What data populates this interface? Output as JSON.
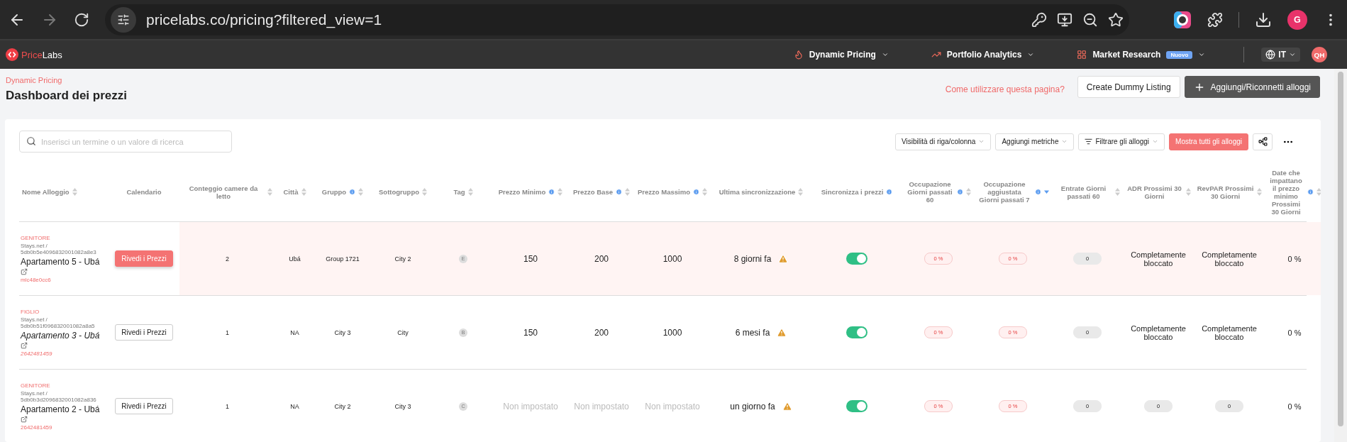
{
  "browser": {
    "url": "pricelabs.co/pricing?filtered_view=1",
    "forward_disabled": true,
    "profile": "G"
  },
  "app_nav": {
    "logo": [
      "Price",
      "Labs"
    ],
    "items": [
      {
        "label": "Dynamic Pricing"
      },
      {
        "label": "Portfolio Analytics"
      },
      {
        "label": "Market Research",
        "badge": "Nuovo"
      }
    ],
    "language": "IT",
    "user": "QH"
  },
  "page": {
    "breadcrumb": "Dynamic Pricing",
    "title": "Dashboard dei prezzi",
    "help_link": "Come utilizzare questa pagina?",
    "buttons": [
      {
        "label": "Create Dummy Listing",
        "kind": "outline"
      },
      {
        "label": "Aggiungi/Riconnetti alloggi",
        "kind": "dark"
      }
    ]
  },
  "toolbar": {
    "search_placeholder": "Inserisci un termine o un valore di ricerca",
    "controls": [
      {
        "label": "Visibilità di riga/colonna",
        "kind": "dropdown"
      },
      {
        "label": "Aggiungi metriche",
        "kind": "dropdown"
      },
      {
        "label": "Filtrare gli alloggi",
        "kind": "filter"
      },
      {
        "label": "Mostra tutti gli alloggi",
        "kind": "primary"
      }
    ]
  },
  "table": {
    "columns": [
      {
        "label": "Nome Alloggio",
        "info": false,
        "sortable": true,
        "sorted": false
      },
      {
        "label": "Calendario",
        "info": false,
        "sortable": false
      },
      {
        "label": "Conteggio camere da letto",
        "info": false,
        "sortable": true,
        "sorted": false
      },
      {
        "label": "Città",
        "info": false,
        "sortable": true,
        "sorted": false
      },
      {
        "label": "Gruppo",
        "info": true,
        "sortable": true,
        "sorted": false
      },
      {
        "label": "Sottogruppo",
        "info": false,
        "sortable": true,
        "sorted": false
      },
      {
        "label": "Tag",
        "info": false,
        "sortable": true,
        "sorted": false
      },
      {
        "label": "Prezzo Minimo",
        "info": true,
        "sortable": true,
        "sorted": false
      },
      {
        "label": "Prezzo Base",
        "info": true,
        "sortable": true,
        "sorted": false
      },
      {
        "label": "Prezzo Massimo",
        "info": true,
        "sortable": true,
        "sorted": false
      },
      {
        "label": "Ultima sincronizzazione",
        "info": false,
        "sortable": true,
        "sorted": false
      },
      {
        "label": "Sincronizza i prezzi",
        "info": true,
        "sortable": false
      },
      {
        "label": "Occupazione Giorni passati 60",
        "info": true,
        "sortable": true,
        "sorted": false
      },
      {
        "label": "Occupazione aggiustata Giorni passati 7",
        "info": true,
        "sortable": true,
        "sorted": true
      },
      {
        "label": "Entrate Giorni passati 60",
        "info": false,
        "sortable": true,
        "sorted": false
      },
      {
        "label": "ADR Prossimi 30 Giorni",
        "info": false,
        "sortable": true,
        "sorted": false
      },
      {
        "label": "RevPAR Prossimi 30 Giorni",
        "info": false,
        "sortable": true,
        "sorted": false
      },
      {
        "label": "Date che impattano il prezzo minimo Prossimi 30 Giorni",
        "info": true,
        "sortable": true,
        "sorted": false
      }
    ],
    "rows": [
      {
        "selected": true,
        "kind": "parent",
        "role": "GENITORE",
        "source": "Stays.net / 5db0b5e4096832001082a8e3",
        "name": "Apartamento 5 - Ubá",
        "id": "mlc48e0cc6",
        "button": "Rivedi i Prezzi",
        "bedrooms": "2",
        "city": "Ubá",
        "group": "Group 1721",
        "subgroup": "City 2",
        "tag": "E",
        "prices": [
          {
            "text": "150",
            "set": true
          },
          {
            "text": "200",
            "set": true
          },
          {
            "text": "1000",
            "set": true
          }
        ],
        "last_sync": "8 giorni fa",
        "sync_on": true,
        "metrics": [
          {
            "text": "0 %",
            "kind": "red-pill"
          },
          {
            "text": "0 %",
            "kind": "red-pill"
          },
          {
            "text": "0",
            "kind": "grey-pill"
          },
          {
            "text": "Completamente bloccato",
            "kind": "text"
          },
          {
            "text": "Completamente bloccato",
            "kind": "text"
          },
          {
            "text": "0 %",
            "kind": "text"
          }
        ]
      },
      {
        "selected": false,
        "kind": "child",
        "role": "FIGLIO",
        "source": "Stays.net / 5db0b51f096832001082a8a5",
        "name": "Apartamento 3 - Ubá",
        "id": "2642481459",
        "button": "Rivedi i Prezzi",
        "bedrooms": "1",
        "city": "NA",
        "group": "City 3",
        "subgroup": "City",
        "tag": "B",
        "prices": [
          {
            "text": "150",
            "set": true
          },
          {
            "text": "200",
            "set": true
          },
          {
            "text": "1000",
            "set": true
          }
        ],
        "last_sync": "6 mesi fa",
        "sync_on": true,
        "metrics": [
          {
            "text": "0 %",
            "kind": "red-pill"
          },
          {
            "text": "0 %",
            "kind": "red-pill"
          },
          {
            "text": "0",
            "kind": "grey-pill"
          },
          {
            "text": "Completamente bloccato",
            "kind": "text"
          },
          {
            "text": "Completamente bloccato",
            "kind": "text"
          },
          {
            "text": "0 %",
            "kind": "text"
          }
        ]
      },
      {
        "selected": false,
        "kind": "parent",
        "role": "GENITORE",
        "source": "Stays.net / 5db0b3d2096832001082a836",
        "name": "Apartamento 2 - Ubá",
        "id": "2642481459",
        "button": "Rivedi i Prezzi",
        "bedrooms": "1",
        "city": "NA",
        "group": "City 2",
        "subgroup": "City 3",
        "tag": "C",
        "prices": [
          {
            "text": "Non impostato",
            "set": false
          },
          {
            "text": "Non impostato",
            "set": false
          },
          {
            "text": "Non impostato",
            "set": false
          }
        ],
        "last_sync": "un giorno fa",
        "sync_on": true,
        "metrics": [
          {
            "text": "0 %",
            "kind": "red-pill"
          },
          {
            "text": "0 %",
            "kind": "red-pill"
          },
          {
            "text": "0",
            "kind": "grey-pill"
          },
          {
            "text": "0",
            "kind": "grey-pill"
          },
          {
            "text": "0",
            "kind": "grey-pill"
          },
          {
            "text": "0 %",
            "kind": "text"
          }
        ]
      }
    ]
  }
}
